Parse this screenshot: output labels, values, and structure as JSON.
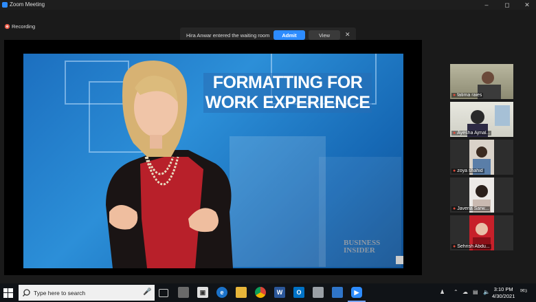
{
  "window": {
    "title": "Zoom Meeting",
    "controls": [
      "minimize-icon",
      "maximize-icon",
      "close-icon"
    ]
  },
  "recording": {
    "label": "Recording"
  },
  "notification": {
    "message": "Hira Anwar entered the waiting room",
    "admit_label": "Admit",
    "view_label": "View",
    "close_symbol": "✕"
  },
  "shared_screen": {
    "headline_line1": "FORMATTING FOR",
    "headline_line2": "WORK EXPERIENCE",
    "watermark_line1": "BUSINESS",
    "watermark_line2": "INSIDER"
  },
  "participants": [
    {
      "name": "fatima raies",
      "muted": true
    },
    {
      "name": "Ayesha Ajmal...",
      "muted": true
    },
    {
      "name": "zoya shahid",
      "muted": true
    },
    {
      "name": "Javeria Sarw...",
      "muted": true
    },
    {
      "name": "Sehrish Abdu...",
      "muted": true
    }
  ],
  "taskbar": {
    "search_placeholder": "Type here to search",
    "apps": [
      "task-view-icon",
      "media-icon",
      "store-icon",
      "edge-icon",
      "folder-icon",
      "chrome-icon",
      "word-icon",
      "outlook-icon",
      "paint-icon",
      "photos-icon",
      "zoom-icon"
    ],
    "time": "3:10 PM",
    "date": "4/30/2021",
    "notification_count": "3"
  },
  "colors": {
    "zoom_blue": "#2d8cff",
    "taskbar": "#101317",
    "mute_red": "#e04a3a"
  }
}
